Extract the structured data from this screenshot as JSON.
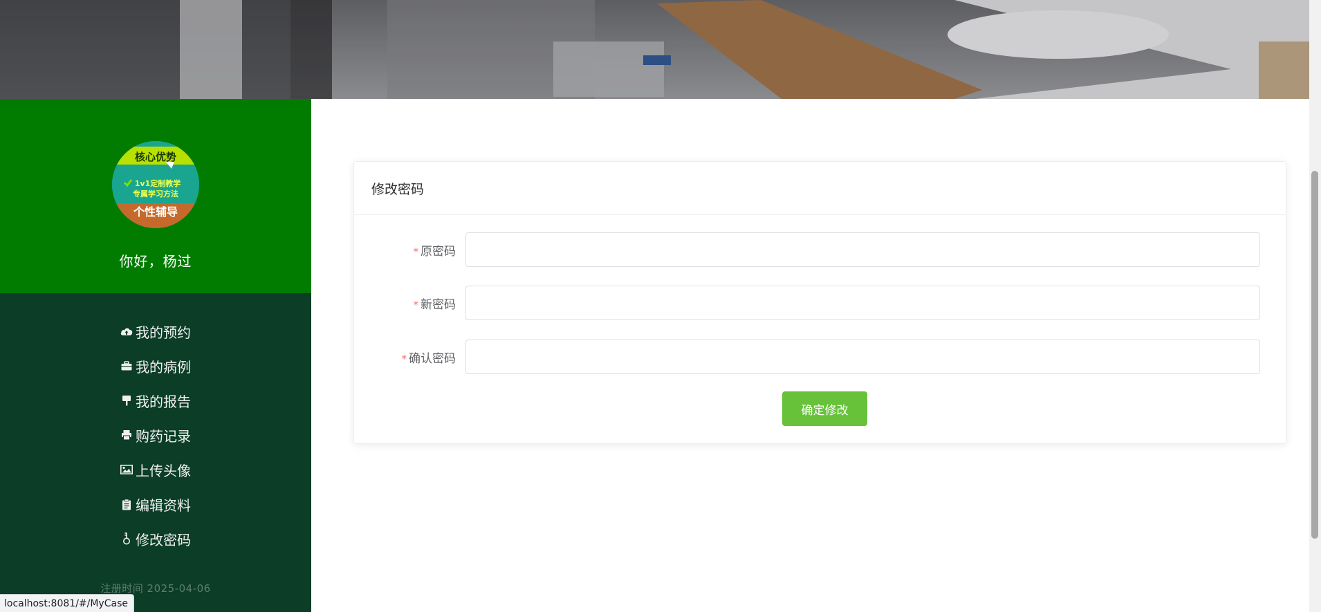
{
  "sidebar": {
    "avatar": {
      "line1": "核心优势",
      "line2": "1v1定制教学",
      "line3": "专属学习方法",
      "line4": "个性辅导"
    },
    "greeting": "你好，杨过",
    "items": [
      {
        "label": "我的预约",
        "icon": "cloud-upload-icon"
      },
      {
        "label": "我的病例",
        "icon": "briefcase-icon"
      },
      {
        "label": "我的报告",
        "icon": "signpost-icon"
      },
      {
        "label": "购药记录",
        "icon": "printer-icon"
      },
      {
        "label": "上传头像",
        "icon": "picture-icon"
      },
      {
        "label": "编辑资料",
        "icon": "clipboard-icon"
      },
      {
        "label": "修改密码",
        "icon": "key-icon"
      }
    ],
    "register_time": "注册时间 2025-04-06"
  },
  "card": {
    "title": "修改密码",
    "fields": [
      {
        "label": "原密码",
        "value": ""
      },
      {
        "label": "新密码",
        "value": ""
      },
      {
        "label": "确认密码",
        "value": ""
      }
    ],
    "submit_label": "确定修改"
  },
  "status_bar": {
    "url": "localhost:8081/#/MyCase"
  },
  "colors": {
    "sidebar_top": "#017c00",
    "sidebar_bottom": "#0b3d27",
    "submit": "#67c23a",
    "required": "#f56c6c"
  }
}
